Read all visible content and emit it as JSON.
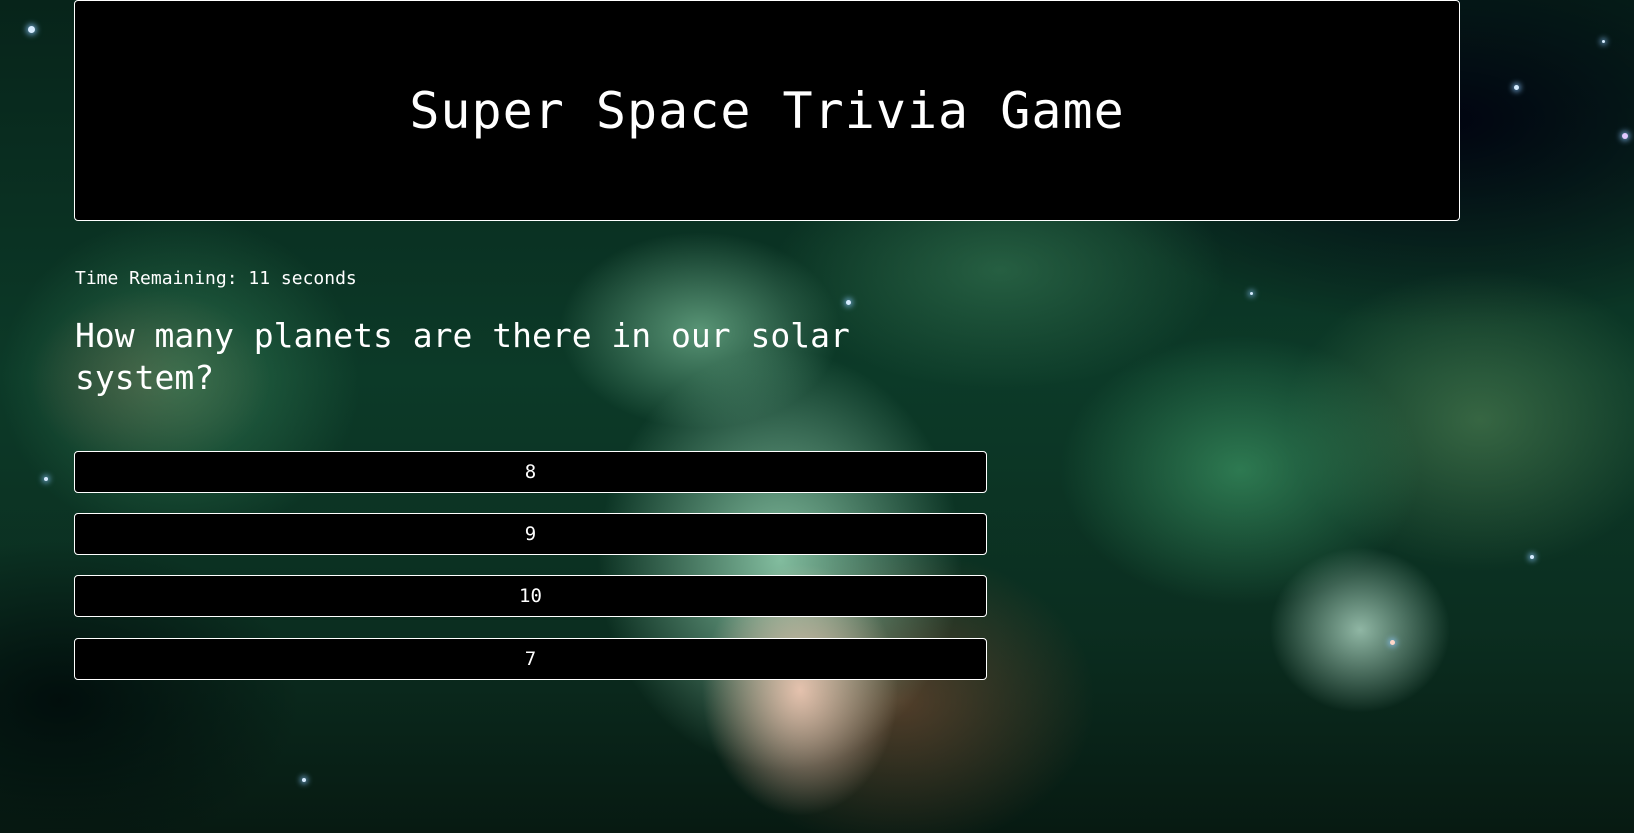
{
  "header": {
    "title": "Super Space Trivia Game"
  },
  "timer": {
    "text": "Time Remaining: 11 seconds",
    "seconds": 11
  },
  "question": {
    "text": "How many planets are there in our solar system?"
  },
  "answers": [
    {
      "label": "8"
    },
    {
      "label": "9"
    },
    {
      "label": "10"
    },
    {
      "label": "7"
    }
  ],
  "colors": {
    "panel_background": "#000000",
    "panel_border": "#ffffff",
    "text": "#ffffff",
    "background_theme": "green nebula space image"
  }
}
